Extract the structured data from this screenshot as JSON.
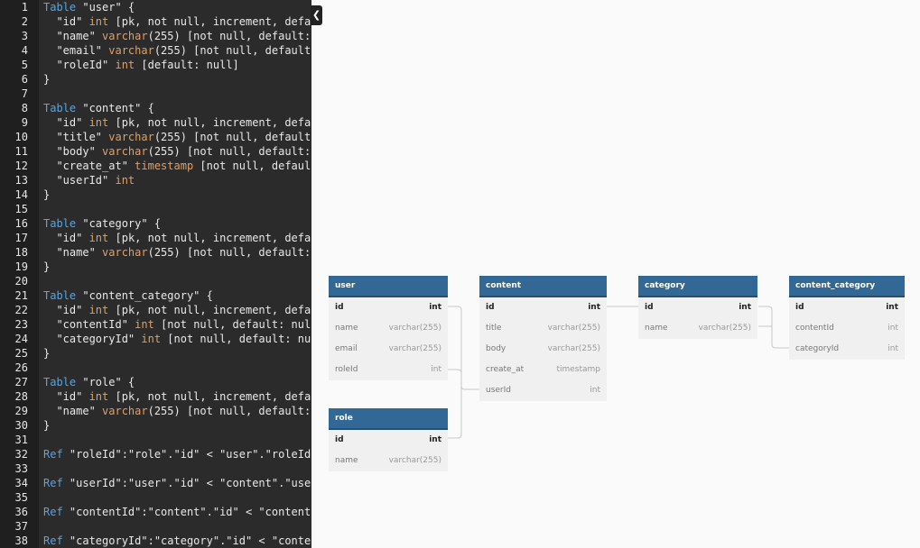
{
  "editor": {
    "lines": [
      [
        [
          "kw",
          "Table"
        ],
        [
          "c",
          " \"user\" {"
        ]
      ],
      [
        [
          "c",
          "  \"id\" "
        ],
        [
          "ty",
          "int"
        ],
        [
          "c",
          " [pk, not null, increment, defa"
        ]
      ],
      [
        [
          "c",
          "  \"name\" "
        ],
        [
          "ty",
          "varchar"
        ],
        [
          "c",
          "(255) [not null, default:"
        ]
      ],
      [
        [
          "c",
          "  \"email\" "
        ],
        [
          "ty",
          "varchar"
        ],
        [
          "c",
          "(255) [not null, default"
        ]
      ],
      [
        [
          "c",
          "  \"roleId\" "
        ],
        [
          "ty",
          "int"
        ],
        [
          "c",
          " [default: null]"
        ]
      ],
      [
        [
          "c",
          "}"
        ]
      ],
      [
        [
          "c",
          ""
        ]
      ],
      [
        [
          "kw",
          "Table"
        ],
        [
          "c",
          " \"content\" {"
        ]
      ],
      [
        [
          "c",
          "  \"id\" "
        ],
        [
          "ty",
          "int"
        ],
        [
          "c",
          " [pk, not null, increment, defa"
        ]
      ],
      [
        [
          "c",
          "  \"title\" "
        ],
        [
          "ty",
          "varchar"
        ],
        [
          "c",
          "(255) [not null, default"
        ]
      ],
      [
        [
          "c",
          "  \"body\" "
        ],
        [
          "ty",
          "varchar"
        ],
        [
          "c",
          "(255) [not null, default:"
        ]
      ],
      [
        [
          "c",
          "  \"create_at\" "
        ],
        [
          "ty",
          "timestamp"
        ],
        [
          "c",
          " [not null, defaul"
        ]
      ],
      [
        [
          "c",
          "  \"userId\" "
        ],
        [
          "ty",
          "int"
        ]
      ],
      [
        [
          "c",
          "}"
        ]
      ],
      [
        [
          "c",
          ""
        ]
      ],
      [
        [
          "kw",
          "Table"
        ],
        [
          "c",
          " \"category\" {"
        ]
      ],
      [
        [
          "c",
          "  \"id\" "
        ],
        [
          "ty",
          "int"
        ],
        [
          "c",
          " [pk, not null, increment, defa"
        ]
      ],
      [
        [
          "c",
          "  \"name\" "
        ],
        [
          "ty",
          "varchar"
        ],
        [
          "c",
          "(255) [not null, default:"
        ]
      ],
      [
        [
          "c",
          "}"
        ]
      ],
      [
        [
          "c",
          ""
        ]
      ],
      [
        [
          "kw",
          "Table"
        ],
        [
          "c",
          " \"content_category\" {"
        ]
      ],
      [
        [
          "c",
          "  \"id\" "
        ],
        [
          "ty",
          "int"
        ],
        [
          "c",
          " [pk, not null, increment, defa"
        ]
      ],
      [
        [
          "c",
          "  \"contentId\" "
        ],
        [
          "ty",
          "int"
        ],
        [
          "c",
          " [not null, default: nul"
        ]
      ],
      [
        [
          "c",
          "  \"categoryId\" "
        ],
        [
          "ty",
          "int"
        ],
        [
          "c",
          " [not null, default: nu"
        ]
      ],
      [
        [
          "c",
          "}"
        ]
      ],
      [
        [
          "c",
          ""
        ]
      ],
      [
        [
          "kw",
          "Table"
        ],
        [
          "c",
          " \"role\" {"
        ]
      ],
      [
        [
          "c",
          "  \"id\" "
        ],
        [
          "ty",
          "int"
        ],
        [
          "c",
          " [pk, not null, increment, defa"
        ]
      ],
      [
        [
          "c",
          "  \"name\" "
        ],
        [
          "ty",
          "varchar"
        ],
        [
          "c",
          "(255) [not null, default:"
        ]
      ],
      [
        [
          "c",
          "}"
        ]
      ],
      [
        [
          "c",
          ""
        ]
      ],
      [
        [
          "kw",
          "Ref"
        ],
        [
          "c",
          " \"roleId\":\"role\".\"id\" < \"user\".\"roleId"
        ]
      ],
      [
        [
          "c",
          ""
        ]
      ],
      [
        [
          "kw",
          "Ref"
        ],
        [
          "c",
          " \"userId\":\"user\".\"id\" < \"content\".\"use"
        ]
      ],
      [
        [
          "c",
          ""
        ]
      ],
      [
        [
          "kw",
          "Ref"
        ],
        [
          "c",
          " \"contentId\":\"content\".\"id\" < \"content"
        ]
      ],
      [
        [
          "c",
          ""
        ]
      ],
      [
        [
          "kw",
          "Ref"
        ],
        [
          "c",
          " \"categoryId\":\"category\".\"id\" < \"conte"
        ]
      ]
    ]
  },
  "colors": {
    "header": "#316896",
    "keyword": "#5ba3e0",
    "type": "#e0a063"
  },
  "tables": [
    {
      "key": "user",
      "name": "user",
      "fields": [
        {
          "name": "id",
          "type": "int",
          "pk": true
        },
        {
          "name": "name",
          "type": "varchar(255)"
        },
        {
          "name": "email",
          "type": "varchar(255)"
        },
        {
          "name": "roleId",
          "type": "int"
        }
      ]
    },
    {
      "key": "content",
      "name": "content",
      "fields": [
        {
          "name": "id",
          "type": "int",
          "pk": true
        },
        {
          "name": "title",
          "type": "varchar(255)"
        },
        {
          "name": "body",
          "type": "varchar(255)"
        },
        {
          "name": "create_at",
          "type": "timestamp"
        },
        {
          "name": "userId",
          "type": "int"
        }
      ]
    },
    {
      "key": "category",
      "name": "category",
      "fields": [
        {
          "name": "id",
          "type": "int",
          "pk": true
        },
        {
          "name": "name",
          "type": "varchar(255)"
        }
      ]
    },
    {
      "key": "content_category",
      "name": "content_category",
      "fields": [
        {
          "name": "id",
          "type": "int",
          "pk": true
        },
        {
          "name": "contentId",
          "type": "int"
        },
        {
          "name": "categoryId",
          "type": "int"
        }
      ]
    },
    {
      "key": "role",
      "name": "role",
      "fields": [
        {
          "name": "id",
          "type": "int",
          "pk": true
        },
        {
          "name": "name",
          "type": "varchar(255)"
        }
      ]
    }
  ],
  "collapse_icon": "chevron-left-icon"
}
